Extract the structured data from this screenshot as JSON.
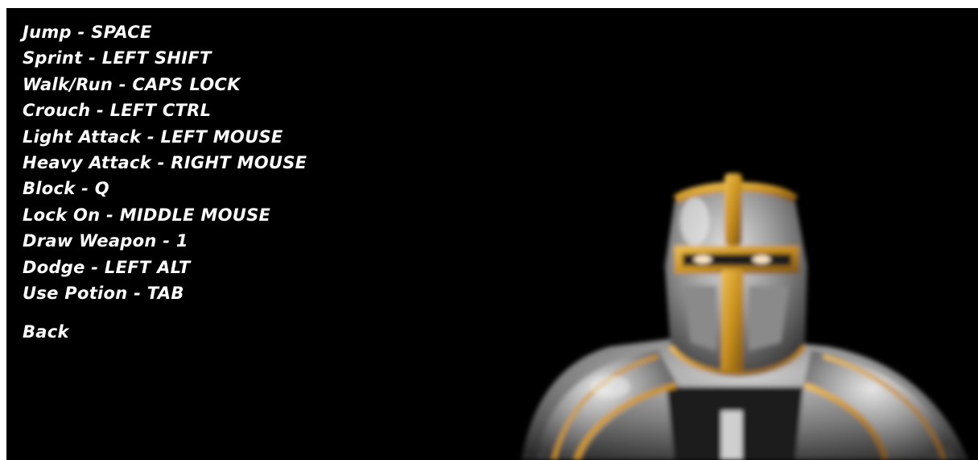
{
  "menu": {
    "controls": [
      {
        "action": "Jump",
        "key": "SPACE"
      },
      {
        "action": "Sprint",
        "key": "LEFT SHIFT"
      },
      {
        "action": "Walk/Run",
        "key": "CAPS LOCK"
      },
      {
        "action": "Crouch",
        "key": "LEFT CTRL"
      },
      {
        "action": "Light Attack",
        "key": "LEFT MOUSE"
      },
      {
        "action": "Heavy Attack",
        "key": "RIGHT MOUSE"
      },
      {
        "action": "Block",
        "key": "Q"
      },
      {
        "action": "Lock On",
        "key": "MIDDLE MOUSE"
      },
      {
        "action": "Draw Weapon",
        "key": "1"
      },
      {
        "action": "Dodge",
        "key": "LEFT ALT"
      },
      {
        "action": "Use Potion",
        "key": "TAB"
      }
    ],
    "separator": " - ",
    "back_label": "Back"
  },
  "colors": {
    "background": "#000000",
    "text": "#ffffff",
    "armor_gold": "#c8901e",
    "armor_steel": "#9a9a9a"
  },
  "icons": {
    "knight_art": "knight-helmet-illustration"
  }
}
